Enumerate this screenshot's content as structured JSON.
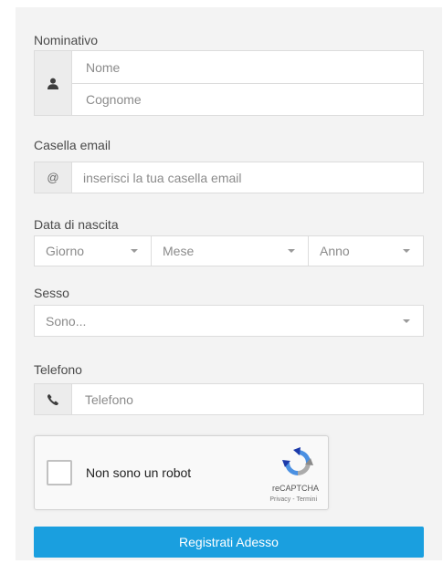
{
  "form": {
    "name_section": {
      "label": "Nominativo",
      "first_name_placeholder": "Nome",
      "last_name_placeholder": "Cognome",
      "icon": "user-icon"
    },
    "email_section": {
      "label": "Casella email",
      "addon_text": "@",
      "placeholder": "inserisci la tua casella email"
    },
    "birth_section": {
      "label": "Data di nascita",
      "day": "Giorno",
      "month": "Mese",
      "year": "Anno"
    },
    "sex_section": {
      "label": "Sesso",
      "selected": "Sono..."
    },
    "phone_section": {
      "label": "Telefono",
      "placeholder": "Telefono",
      "icon": "phone-icon"
    },
    "captcha": {
      "checkbox_label": "Non sono un robot",
      "brand": "reCAPTCHA",
      "privacy": "Privacy",
      "separator": "-",
      "terms": "Termini"
    },
    "submit_label": "Registrati Adesso"
  },
  "colors": {
    "panel_bg": "#f3f3f3",
    "submit_bg": "#1a9fdf",
    "addon_bg": "#ececec"
  }
}
